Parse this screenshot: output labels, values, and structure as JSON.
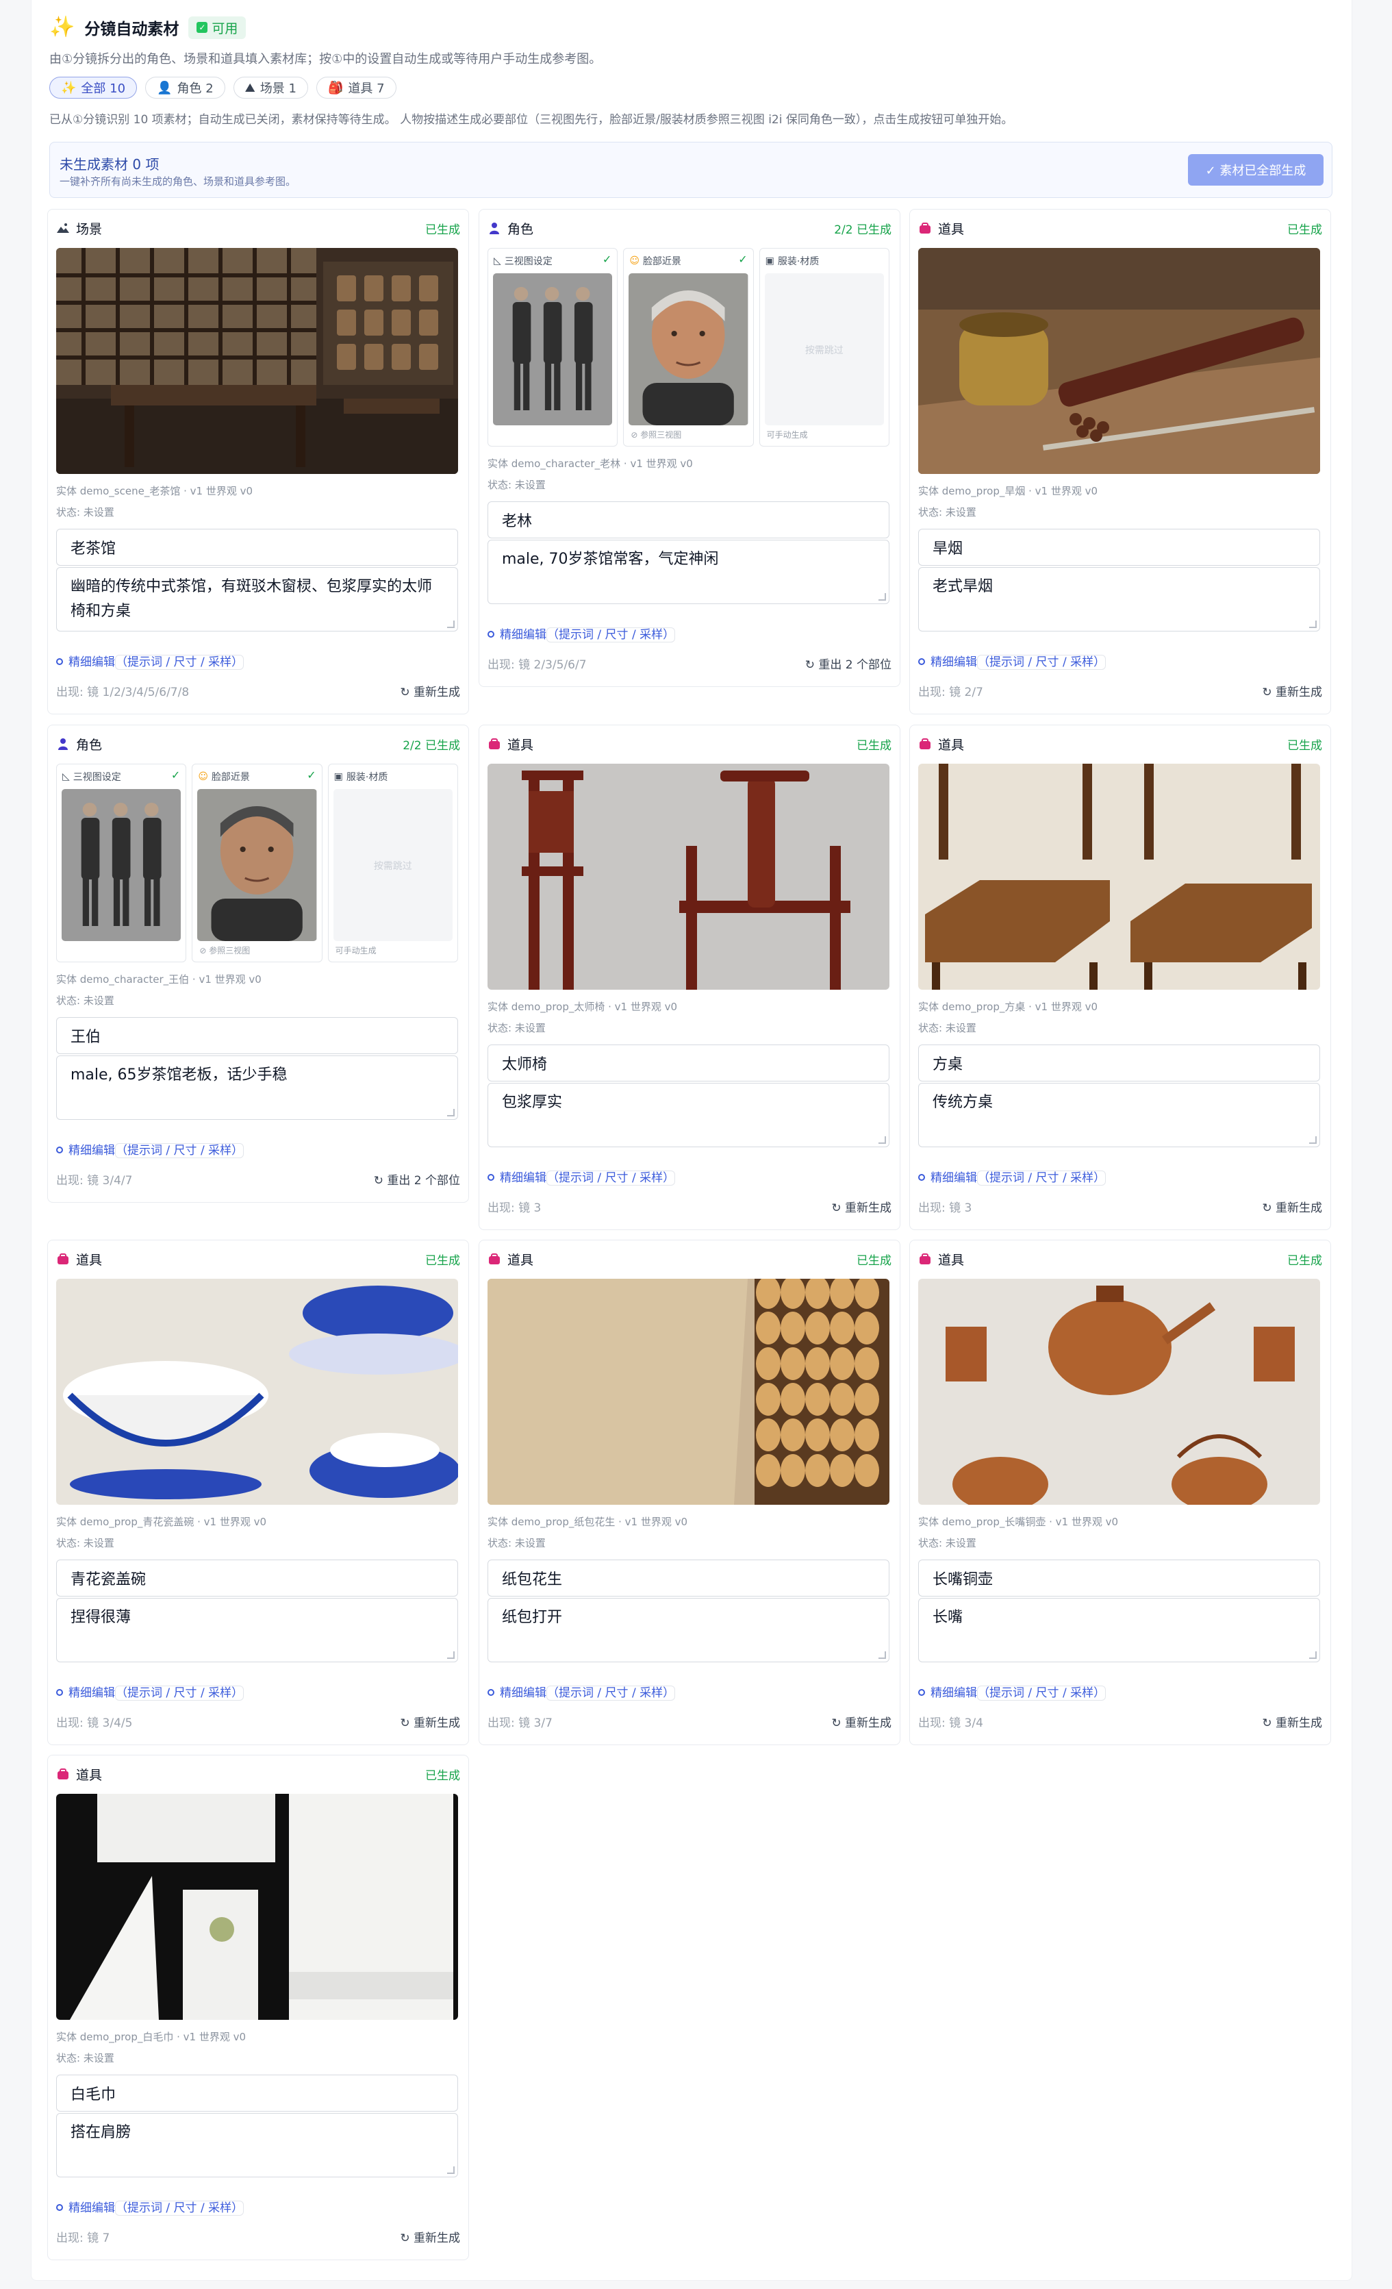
{
  "header": {
    "title": "分镜自动素材",
    "status": "可用",
    "desc": "由①分镜拆分出的角色、场景和道具填入素材库；按①中的设置自动生成或等待用户手动生成参考图。",
    "note": "已从①分镜识别 10 项素材；自动生成已关闭，素材保持等待生成。 人物按描述生成必要部位（三视图先行，脸部近景/服装材质参照三视图 i2i 保同角色一致），点击生成按钮可单独开始。"
  },
  "filters": [
    {
      "label": "全部 10",
      "icon": "sparkle-icon"
    },
    {
      "label": "角色 2",
      "icon": "person-icon"
    },
    {
      "label": "场景 1",
      "icon": "scene-icon"
    },
    {
      "label": "道具 7",
      "icon": "prop-icon"
    }
  ],
  "pending": {
    "title": "未生成素材 0 项",
    "sub": "一键补齐所有尚未生成的角色、场景和道具参考图。",
    "button": "✓ 素材已全部生成"
  },
  "labels": {
    "edit": "精细编辑",
    "edit_sub": "（提示词 / 尺寸 / 采样）",
    "regen": "重新生成",
    "three_view": "三视图设定",
    "face": "脸部近景",
    "costume": "服装·材质",
    "ref_three": "参照三视图",
    "manual": "可手动生成",
    "skip": "按需跳过"
  },
  "cards": [
    {
      "type": "场景",
      "status": "已生成",
      "entity": "实体 demo_scene_老茶馆 · v1   世界观 v0",
      "state": "状态: 未设置",
      "name": "老茶馆",
      "desc": "幽暗的传统中式茶馆，有斑驳木窗棂、包浆厚实的太师椅和方桌",
      "appear": "出现: 镜 1/2/3/4/5/6/7/8",
      "action": "重新生成"
    },
    {
      "type": "角色",
      "status": "2/2 已生成",
      "entity": "实体 demo_character_老林 · v1   世界观 v0",
      "state": "状态: 未设置",
      "name": "老林",
      "desc": "male, 70岁茶馆常客，气定神闲",
      "appear": "出现: 镜 2/3/5/6/7",
      "action": "重出 2 个部位"
    },
    {
      "type": "道具",
      "status": "已生成",
      "entity": "实体 demo_prop_旱烟 · v1   世界观 v0",
      "state": "状态: 未设置",
      "name": "旱烟",
      "desc": "老式旱烟",
      "appear": "出现: 镜 2/7",
      "action": "重新生成"
    },
    {
      "type": "角色",
      "status": "2/2 已生成",
      "entity": "实体 demo_character_王伯 · v1   世界观 v0",
      "state": "状态: 未设置",
      "name": "王伯",
      "desc": "male, 65岁茶馆老板，话少手稳",
      "appear": "出现: 镜 3/4/7",
      "action": "重出 2 个部位"
    },
    {
      "type": "道具",
      "status": "已生成",
      "entity": "实体 demo_prop_太师椅 · v1   世界观 v0",
      "state": "状态: 未设置",
      "name": "太师椅",
      "desc": "包浆厚实",
      "appear": "出现: 镜 3",
      "action": "重新生成"
    },
    {
      "type": "道具",
      "status": "已生成",
      "entity": "实体 demo_prop_方桌 · v1   世界观 v0",
      "state": "状态: 未设置",
      "name": "方桌",
      "desc": "传统方桌",
      "appear": "出现: 镜 3",
      "action": "重新生成"
    },
    {
      "type": "道具",
      "status": "已生成",
      "entity": "实体 demo_prop_青花瓷盖碗 · v1   世界观 v0",
      "state": "状态: 未设置",
      "name": "青花瓷盖碗",
      "desc": "捏得很薄",
      "appear": "出现: 镜 3/4/5",
      "action": "重新生成"
    },
    {
      "type": "道具",
      "status": "已生成",
      "entity": "实体 demo_prop_纸包花生 · v1   世界观 v0",
      "state": "状态: 未设置",
      "name": "纸包花生",
      "desc": "纸包打开",
      "appear": "出现: 镜 3/7",
      "action": "重新生成"
    },
    {
      "type": "道具",
      "status": "已生成",
      "entity": "实体 demo_prop_长嘴铜壶 · v1   世界观 v0",
      "state": "状态: 未设置",
      "name": "长嘴铜壶",
      "desc": "长嘴",
      "appear": "出现: 镜 3/4",
      "action": "重新生成"
    },
    {
      "type": "道具",
      "status": "已生成",
      "entity": "实体 demo_prop_白毛巾 · v1   世界观 v0",
      "state": "状态: 未设置",
      "name": "白毛巾",
      "desc": "搭在肩膀",
      "appear": "出现: 镜 7",
      "action": "重新生成"
    }
  ]
}
